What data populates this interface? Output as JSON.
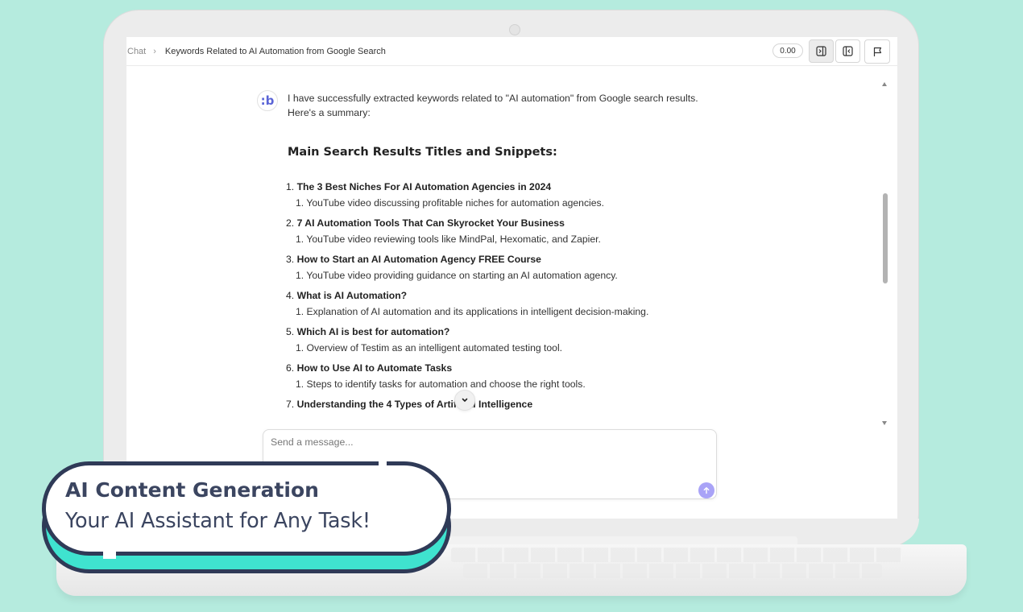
{
  "header": {
    "breadcrumb_root": "Chat",
    "breadcrumb_current": "Keywords Related to AI Automation from Google Search",
    "score": "0.00"
  },
  "icons": {
    "assistant_avatar": "brand-logo-icon",
    "panel_right": "panel-right-icon",
    "panel_left": "panel-left-icon",
    "flag": "flag-icon",
    "scroll_down": "chevron-down-icon",
    "send": "arrow-up-icon"
  },
  "colors": {
    "accent": "#a9a3f7",
    "brand": "#5a64d6",
    "badge_accent": "#3fe3cf",
    "badge_text": "#3b4560"
  },
  "assistant": {
    "logo_text": ":b",
    "intro": "I have successfully extracted keywords related to \"AI automation\" from Google search results. Here's a summary:"
  },
  "section": {
    "heading": "Main Search Results Titles and Snippets:"
  },
  "results": [
    {
      "num": "1.",
      "title": "The 3 Best Niches For AI Automation Agencies in 2024",
      "snippet": "1. YouTube video discussing profitable niches for automation agencies."
    },
    {
      "num": "2.",
      "title": "7 AI Automation Tools That Can Skyrocket Your Business",
      "snippet": "1. YouTube video reviewing tools like MindPal, Hexomatic, and Zapier."
    },
    {
      "num": "3.",
      "title": "How to Start an AI Automation Agency FREE Course",
      "snippet": "1. YouTube video providing guidance on starting an AI automation agency."
    },
    {
      "num": "4.",
      "title": "What is AI Automation?",
      "snippet": "1. Explanation of AI automation and its applications in intelligent decision-making."
    },
    {
      "num": "5.",
      "title": "Which AI is best for automation?",
      "snippet": "1. Overview of Testim as an intelligent automated testing tool."
    },
    {
      "num": "6.",
      "title": "How to Use AI to Automate Tasks",
      "snippet": "1. Steps to identify tasks for automation and choose the right tools."
    },
    {
      "num": "7.",
      "title": "Understanding the 4 Types of Artificial Intelligence",
      "snippet": ""
    }
  ],
  "composer": {
    "placeholder": "Send a message..."
  },
  "badge": {
    "title": "AI Content Generation",
    "subtitle": "Your AI Assistant for Any Task!"
  }
}
